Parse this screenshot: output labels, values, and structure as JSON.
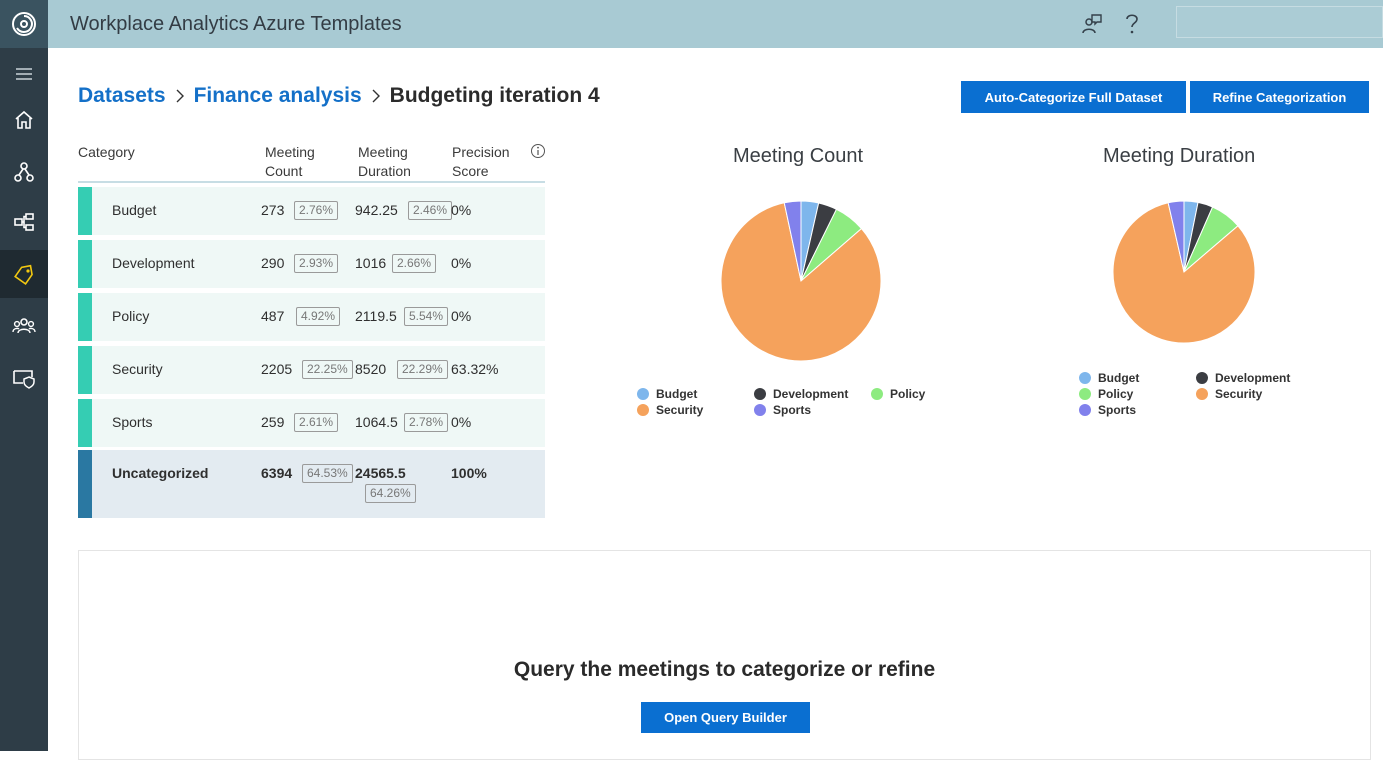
{
  "app": {
    "title": "Workplace Analytics Azure Templates"
  },
  "rail": {
    "items": [
      {
        "icon": "menu-icon"
      },
      {
        "icon": "home-icon"
      },
      {
        "icon": "network-icon"
      },
      {
        "icon": "hierarchy-icon"
      },
      {
        "icon": "tag-icon",
        "active": true
      },
      {
        "icon": "people-icon"
      },
      {
        "icon": "shield-icon"
      }
    ]
  },
  "breadcrumb": {
    "items": [
      "Datasets",
      "Finance analysis"
    ],
    "current": "Budgeting iteration 4"
  },
  "actions": {
    "auto_categorize": "Auto-Categorize Full Dataset",
    "refine": "Refine Categorization"
  },
  "table": {
    "headers": {
      "category": "Category",
      "count_1": "Meeting",
      "count_2": "Count",
      "duration_1": "Meeting",
      "duration_2": "Duration",
      "precision_1": "Precision",
      "precision_2": "Score"
    },
    "rows": [
      {
        "category": "Budget",
        "count": "273",
        "count_pct": "2.76%",
        "duration": "942.25",
        "duration_pct": "2.46%",
        "precision": "0%"
      },
      {
        "category": "Development",
        "count": "290",
        "count_pct": "2.93%",
        "duration": "1016",
        "duration_pct": "2.66%",
        "precision": "0%"
      },
      {
        "category": "Policy",
        "count": "487",
        "count_pct": "4.92%",
        "duration": "2119.5",
        "duration_pct": "5.54%",
        "precision": "0%"
      },
      {
        "category": "Security",
        "count": "2205",
        "count_pct": "22.25%",
        "duration": "8520",
        "duration_pct": "22.29%",
        "precision": "63.32%"
      },
      {
        "category": "Sports",
        "count": "259",
        "count_pct": "2.61%",
        "duration": "1064.5",
        "duration_pct": "2.78%",
        "precision": "0%"
      }
    ],
    "uncategorized": {
      "category": "Uncategorized",
      "count": "6394",
      "count_pct": "64.53%",
      "duration": "24565.5",
      "duration_pct": "64.26%",
      "precision": "100%"
    }
  },
  "colors": {
    "Budget": "#7eb6ec",
    "Development": "#3b3d42",
    "Policy": "#8deb80",
    "Security": "#f5a25c",
    "Uncategorized": "#f5a25c",
    "Sports": "#8181ec"
  },
  "chart_data": [
    {
      "type": "pie",
      "title": "Meeting Count",
      "categories": [
        "Budget",
        "Development",
        "Policy",
        "Uncategorized",
        "Sports"
      ],
      "values": [
        273,
        290,
        487,
        6394,
        259
      ],
      "legend": [
        "Budget",
        "Development",
        "Policy",
        "Security",
        "Sports"
      ]
    },
    {
      "type": "pie",
      "title": "Meeting Duration",
      "categories": [
        "Budget",
        "Development",
        "Policy",
        "Uncategorized",
        "Sports"
      ],
      "values": [
        942.25,
        1016,
        2119.5,
        24565.5,
        1064.5
      ],
      "legend": [
        "Budget",
        "Development",
        "Policy",
        "Security",
        "Sports"
      ]
    }
  ],
  "query": {
    "title": "Query the meetings to categorize or refine",
    "button": "Open Query Builder"
  }
}
